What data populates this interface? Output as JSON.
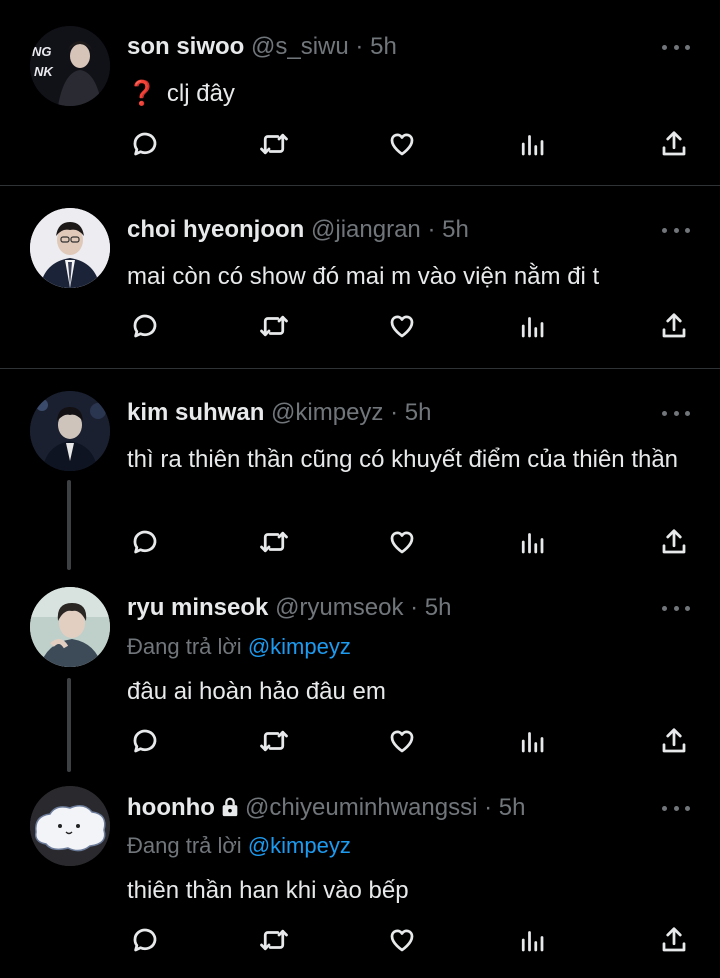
{
  "tweets": [
    {
      "name": "son siwoo",
      "handle": "@s_siwu",
      "separator": "·",
      "time": "5h",
      "prefix_emoji": "❓",
      "text": "clj đây",
      "avatar_colors": [
        "#1c1c24",
        "#e8e8ee"
      ]
    },
    {
      "name": "choi hyeonjoon",
      "handle": "@jiangran",
      "separator": "·",
      "time": "5h",
      "text": "mai còn có show đó mai m vào viện nằm đi t",
      "avatar_colors": [
        "#e9e9ef",
        "#1b2338"
      ]
    },
    {
      "name": "kim suhwan",
      "handle": "@kimpeyz",
      "separator": "·",
      "time": "5h",
      "text": "thì ra thiên thần cũng có khuyết điểm của thiên thần",
      "avatar_colors": [
        "#151b2c",
        "#cfc4bb"
      ]
    },
    {
      "name": "ryu minseok",
      "handle": "@ryumseok",
      "separator": "·",
      "time": "5h",
      "replying_prefix": "Đang trả lời",
      "replying_to": "@kimpeyz",
      "text": "đâu ai hoàn hảo đâu em",
      "avatar_colors": [
        "#c9d6d2",
        "#3d4a58"
      ]
    },
    {
      "name": "hoonho",
      "handle": "@chiyeuminhwangssi",
      "separator": "·",
      "time": "5h",
      "replying_prefix": "Đang trả lời",
      "replying_to": "@kimpeyz",
      "text": "thiên thần han khi vào bếp",
      "avatar_colors": [
        "#2a2a2e",
        "#f2f4f8"
      ]
    }
  ],
  "icons": [
    "reply-icon",
    "retweet-icon",
    "like-icon",
    "views-icon",
    "share-icon",
    "more-icon",
    "lock-icon"
  ],
  "colors": {
    "background": "#000000",
    "text": "#e7e9ea",
    "muted": "#71767b",
    "link": "#1d9bf0",
    "divider": "#2f3336"
  }
}
